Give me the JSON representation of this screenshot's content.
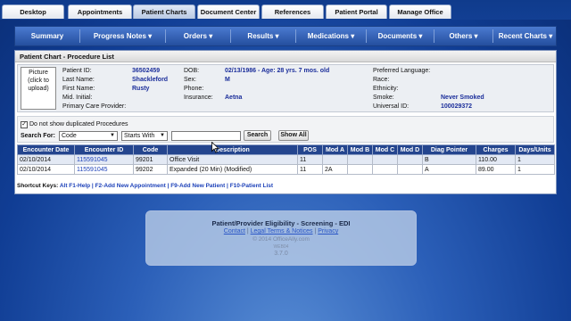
{
  "top_tabs": [
    {
      "label": "Desktop",
      "active": false
    },
    {
      "label": "Appointments",
      "active": false
    },
    {
      "label": "Patient Charts",
      "active": true
    },
    {
      "label": "Document Center",
      "active": false
    },
    {
      "label": "References",
      "active": false
    },
    {
      "label": "Patient Portal",
      "active": false
    },
    {
      "label": "Manage Office",
      "active": false
    }
  ],
  "nav": [
    {
      "label": "Summary"
    },
    {
      "label": "Progress Notes ▾"
    },
    {
      "label": "Orders ▾"
    },
    {
      "label": "Results ▾"
    },
    {
      "label": "Medications ▾"
    },
    {
      "label": "Documents ▾"
    },
    {
      "label": "Others ▾"
    },
    {
      "label": "Recent Charts ▾"
    }
  ],
  "panel": {
    "title": "Patient Chart - Procedure List"
  },
  "picture": {
    "line1": "Picture",
    "line2": "(click to",
    "line3": "upload)"
  },
  "patient": {
    "id_label": "Patient ID:",
    "id": "36502459",
    "last_label": "Last Name:",
    "last": "Shackleford",
    "first_label": "First Name:",
    "first": "Rusty",
    "mid_label": "Mid. Initial:",
    "mid": "",
    "pcp_label": "Primary Care Provider:",
    "pcp": "",
    "dob_label": "DOB:",
    "dob": "02/13/1986 - Age: 28 yrs. 7 mos. old",
    "sex_label": "Sex:",
    "sex": "M",
    "phone_label": "Phone:",
    "phone": "",
    "ins_label": "Insurance:",
    "ins": "Aetna",
    "lang_label": "Preferred Language:",
    "lang": "",
    "race_label": "Race:",
    "race": "",
    "eth_label": "Ethnicity:",
    "eth": "",
    "smoke_label": "Smoke:",
    "smoke": "Never Smoked",
    "uid_label": "Universal ID:",
    "uid": "100029372"
  },
  "filters": {
    "dup_checked": true,
    "dup_label": "Do not show duplicated Procedures",
    "search_for_label": "Search For:",
    "search_field": "Code",
    "match_mode": "Starts With",
    "search_value": "",
    "search_button": "Search",
    "show_all_button": "Show All"
  },
  "table": {
    "headers": [
      "Encounter Date",
      "Encounter ID",
      "Code",
      "Description",
      "POS",
      "Mod A",
      "Mod B",
      "Mod C",
      "Mod D",
      "Diag Pointer",
      "Charges",
      "Days/Units"
    ],
    "rows": [
      [
        "02/10/2014",
        "115591045",
        "99201",
        "Office Visit",
        "11",
        "",
        "",
        "",
        "",
        "B",
        "110.00",
        "1"
      ],
      [
        "02/10/2014",
        "115591045",
        "99202",
        "Expanded (20 Min) (Modified)",
        "11",
        "2A",
        "",
        "",
        "",
        "A",
        "89.00",
        "1"
      ]
    ]
  },
  "shortcuts": {
    "label": "Shortcut Keys:",
    "k1": "Alt F1-Help",
    "sep": " | ",
    "k2": "F2-Add New Appointment",
    "k3": "F9-Add New Patient",
    "k4": "F10-Patient List"
  },
  "footer": {
    "title": "Patient/Provider Eligibility - Screening - EDI",
    "contact": "Contact",
    "legal": "Legal Terms & Notices",
    "privacy": "Privacy",
    "sep": " | ",
    "copyright": "© 2014 OfficeAlly.com",
    "server": "WEB04",
    "version": "3.7.0"
  },
  "colors": {
    "nav": "#2f5cad",
    "header_row": "#24458e",
    "link": "#1a3fb8"
  }
}
